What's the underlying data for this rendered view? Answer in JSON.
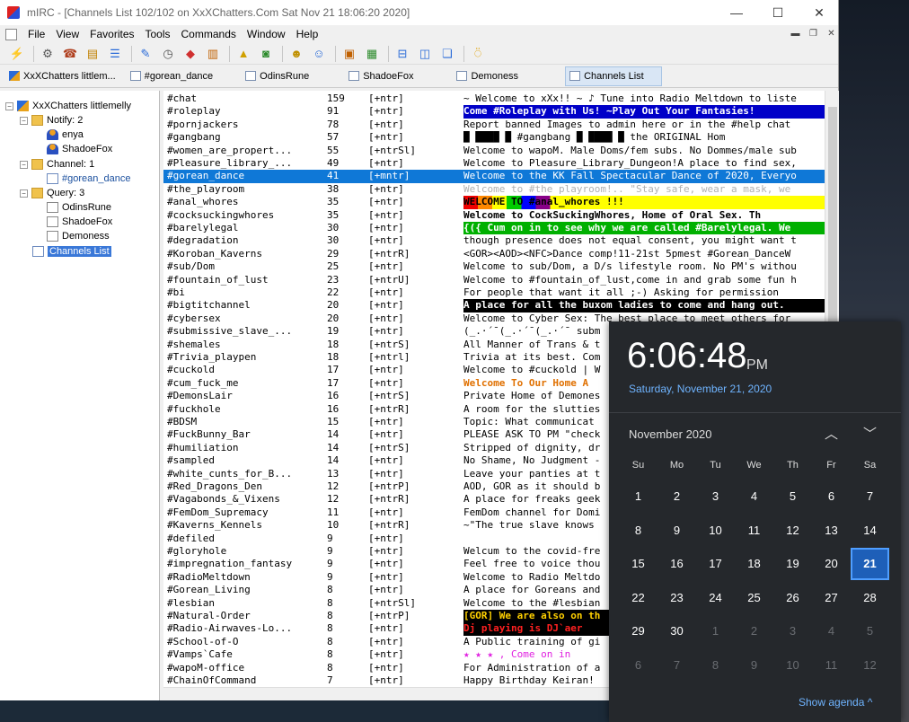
{
  "window": {
    "title": "mIRC - [Channels List 102/102 on XxXChatters.Com Sat Nov 21 18:06:20 2020]",
    "controls": {
      "min": "—",
      "max": "☐",
      "close": "✕"
    }
  },
  "menu": [
    "File",
    "View",
    "Favorites",
    "Tools",
    "Commands",
    "Window",
    "Help"
  ],
  "switchbar": [
    {
      "label": "XxXChatters littlem...",
      "icon": "network-icon"
    },
    {
      "label": "#gorean_dance",
      "icon": "channel-icon"
    },
    {
      "label": "OdinsRune",
      "icon": "query-icon"
    },
    {
      "label": "ShadoeFox",
      "icon": "query-icon"
    },
    {
      "label": "Demoness",
      "icon": "query-icon"
    },
    {
      "label": "Channels List",
      "icon": "list-icon",
      "active": true
    }
  ],
  "tree": {
    "server": "XxXChatters littlemelly",
    "notify_label": "Notify: 2",
    "notify": [
      "enya",
      "ShadoeFox"
    ],
    "channel_label": "Channel: 1",
    "channels": [
      "#gorean_dance"
    ],
    "query_label": "Query: 3",
    "queries": [
      "OdinsRune",
      "ShadoeFox",
      "Demoness"
    ],
    "list": "Channels List"
  },
  "channels": [
    {
      "name": "#chat",
      "users": "159",
      "modes": "[+ntr]",
      "topic": "~ Welcome to xXx!! ~ ♪ Tune into Radio Meltdown to liste"
    },
    {
      "name": "#roleplay",
      "users": "91",
      "modes": "[+ntr]",
      "topic": " Come #Roleplay with Us! ~Play Out Your Fantasies!",
      "style": "blue"
    },
    {
      "name": "#pornjackers",
      "users": "78",
      "modes": "[+ntr]",
      "topic": " Report banned Images to admin here or in the #help chat"
    },
    {
      "name": "#gangbang",
      "users": "57",
      "modes": "[+ntr]",
      "topic": "█ ████ █ #gangbang █ ████ █  the ORIGINAL  Hom"
    },
    {
      "name": "#women_are_propert...",
      "users": "55",
      "modes": "[+ntrSl]",
      "topic": "Welcome to wapoM. Male Doms/fem subs. No Dommes/male sub"
    },
    {
      "name": "#Pleasure_library_...",
      "users": "49",
      "modes": "[+ntr]",
      "topic": "Welcome to Pleasure_Library_Dungeon!A place to find sex,"
    },
    {
      "name": "#gorean_dance",
      "users": "41",
      "modes": "[+mntr]",
      "topic": "Welcome to the KK Fall Spectacular Dance of 2020, Everyo",
      "selected": true
    },
    {
      "name": "#the_playroom",
      "users": "38",
      "modes": "[+ntr]",
      "topic": "Welcome to #the playroom!..  \"Stay safe, wear a mask, we",
      "style": "faint"
    },
    {
      "name": "#anal_whores",
      "users": "35",
      "modes": "[+ntr]",
      "topic": "           WELCOME TO #anal_whores !!! ",
      "style": "rainbow"
    },
    {
      "name": "#cocksuckingwhores",
      "users": "35",
      "modes": "[+ntr]",
      "topic": "Welcome to CockSuckingWhores, Home of Oral Sex. Th",
      "style": "bold"
    },
    {
      "name": "#barelylegal",
      "users": "30",
      "modes": "[+ntr]",
      "topic": "{({ Cum on in to see why we are called #Barelylegal. We",
      "style": "green"
    },
    {
      "name": "#degradation",
      "users": "30",
      "modes": "[+ntr]",
      "topic": "though presence does not equal consent, you might want t"
    },
    {
      "name": "#Koroban_Kaverns",
      "users": "29",
      "modes": "[+ntrR]",
      "topic": "<GOR><AOD><NFC>Dance comp!11-21st  5pmest #Gorean_DanceW"
    },
    {
      "name": "#sub/Dom",
      "users": "25",
      "modes": "[+ntr]",
      "topic": "Welcome to sub/Dom, a D/s lifestyle room. No PM's withou"
    },
    {
      "name": "#fountain_of_lust",
      "users": "23",
      "modes": "[+ntrU]",
      "topic": "Welcome to #fountain_of_lust,come in and grab some fun h"
    },
    {
      "name": "#bi",
      "users": "22",
      "modes": "[+ntr]",
      "topic": " For people that want it all ;-)   Asking for permission"
    },
    {
      "name": "#bigtitchannel",
      "users": "20",
      "modes": "[+ntr]",
      "topic": " A place for all the buxom ladies to come and hang out.",
      "style": "inverse"
    },
    {
      "name": "#cybersex",
      "users": "20",
      "modes": "[+ntr]",
      "topic": "Welcome to Cyber Sex: The best place to meet others for"
    },
    {
      "name": "#submissive_slave_...",
      "users": "19",
      "modes": "[+ntr]",
      "topic": "(_.·´¯(_.·´¯(_.·´¯ subm"
    },
    {
      "name": "#shemales",
      "users": "18",
      "modes": "[+ntrS]",
      "topic": "All Manner of Trans & t"
    },
    {
      "name": "#Trivia_playpen",
      "users": "18",
      "modes": "[+ntrl]",
      "topic": "Trivia at its best. Com"
    },
    {
      "name": "#cuckold",
      "users": "17",
      "modes": "[+ntr]",
      "topic": "Welcome to #cuckold | W"
    },
    {
      "name": "#cum_fuck_me",
      "users": "17",
      "modes": "[+ntr]",
      "topic": " Welcome To Our Home A",
      "style": "orange"
    },
    {
      "name": "#DemonsLair",
      "users": "16",
      "modes": "[+ntrS]",
      "topic": "Private Home of Demones"
    },
    {
      "name": "#fuckhole",
      "users": "16",
      "modes": "[+ntrR]",
      "topic": "A room for the slutties"
    },
    {
      "name": "#BDSM",
      "users": "15",
      "modes": "[+ntr]",
      "topic": " Topic: What communicat"
    },
    {
      "name": "#FuckBunny_Bar",
      "users": "14",
      "modes": "[+ntr]",
      "topic": "PLEASE ASK TO PM \"check"
    },
    {
      "name": "#humiliation",
      "users": "14",
      "modes": "[+ntrS]",
      "topic": "Stripped of dignity, dr"
    },
    {
      "name": "#sampled",
      "users": "14",
      "modes": "[+ntr]",
      "topic": "No Shame, No Judgment -"
    },
    {
      "name": "#white_cunts_for_B...",
      "users": "13",
      "modes": "[+ntr]",
      "topic": "Leave your panties at t"
    },
    {
      "name": "#Red_Dragons_Den",
      "users": "12",
      "modes": "[+ntrP]",
      "topic": "AOD, GOR as it should b"
    },
    {
      "name": "#Vagabonds_&_Vixens",
      "users": "12",
      "modes": "[+ntrR]",
      "topic": "A place for freaks geek"
    },
    {
      "name": "#FemDom_Supremacy",
      "users": "11",
      "modes": "[+ntr]",
      "topic": "FemDom channel for Domi"
    },
    {
      "name": "#Kaverns_Kennels",
      "users": "10",
      "modes": "[+ntrR]",
      "topic": "~\"The true slave knows"
    },
    {
      "name": "#defiled",
      "users": "9",
      "modes": "[+ntr]",
      "topic": ""
    },
    {
      "name": "#gloryhole",
      "users": "9",
      "modes": "[+ntr]",
      "topic": "Welcum to the covid-fre"
    },
    {
      "name": "#impregnation_fantasy",
      "users": "9",
      "modes": "[+ntr]",
      "topic": "Feel free to voice thou"
    },
    {
      "name": "#RadioMeltdown",
      "users": "9",
      "modes": "[+ntr]",
      "topic": "Welcome to Radio Meltdo"
    },
    {
      "name": "#Gorean_Living",
      "users": "8",
      "modes": "[+ntr]",
      "topic": "A place for Goreans and"
    },
    {
      "name": "#lesbian",
      "users": "8",
      "modes": "[+ntrSl]",
      "topic": "Welcome to the #lesbian"
    },
    {
      "name": "#Natural-Order",
      "users": "8",
      "modes": "[+ntrP]",
      "topic": "[GOR] We are also on th",
      "style": "dark"
    },
    {
      "name": "#Radio-Airwaves-Lo...",
      "users": "8",
      "modes": "[+ntr]",
      "topic": " Dj playing is   DJ`aer",
      "style": "djred"
    },
    {
      "name": "#School-of-O",
      "users": "8",
      "modes": "[+ntr]",
      "topic": "A Public training of gi"
    },
    {
      "name": "#Vamps`Cafe",
      "users": "8",
      "modes": "[+ntr]",
      "topic": "★   ★  ★ , Come on in",
      "style": "stars"
    },
    {
      "name": "#wapoM-office",
      "users": "8",
      "modes": "[+ntr]",
      "topic": "For Administration of a"
    },
    {
      "name": "#ChainOfCommand",
      "users": "7",
      "modes": "[+ntr]",
      "topic": "Happy Birthday Keiran!"
    }
  ],
  "clock": {
    "time": "6:06:48",
    "ampm": "PM",
    "date": "Saturday, November 21, 2020",
    "month": "November 2020",
    "weekdays": [
      "Su",
      "Mo",
      "Tu",
      "We",
      "Th",
      "Fr",
      "Sa"
    ],
    "days": [
      [
        "1",
        "2",
        "3",
        "4",
        "5",
        "6",
        "7"
      ],
      [
        "8",
        "9",
        "10",
        "11",
        "12",
        "13",
        "14"
      ],
      [
        "15",
        "16",
        "17",
        "18",
        "19",
        "20",
        "21"
      ],
      [
        "22",
        "23",
        "24",
        "25",
        "26",
        "27",
        "28"
      ],
      [
        "29",
        "30",
        "1",
        "2",
        "3",
        "4",
        "5"
      ],
      [
        "6",
        "7",
        "8",
        "9",
        "10",
        "11",
        "12"
      ]
    ],
    "today": "21",
    "agenda": "Show agenda ^"
  }
}
